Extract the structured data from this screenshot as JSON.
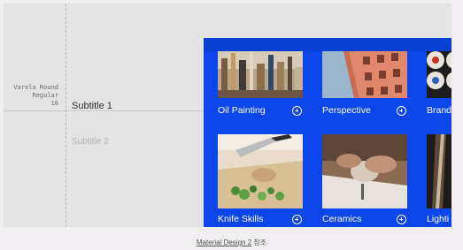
{
  "spec": {
    "font_name": "Varela Round",
    "font_weight": "Regular",
    "font_size": "16"
  },
  "samples": {
    "subtitle_1": "Subtitle 1",
    "subtitle_2": "Subtitle 2"
  },
  "colors": {
    "grid_background": "#0c46ea",
    "label": "#ffffff"
  },
  "tiles_row_1": [
    {
      "label": "Oil Painting",
      "icon": "add-circle-icon"
    },
    {
      "label": "Perspective",
      "icon": "add-circle-icon"
    },
    {
      "label": "Brand",
      "icon": "add-circle-icon"
    }
  ],
  "tiles_row_2": [
    {
      "label": "Knife Skills",
      "icon": "add-circle-icon"
    },
    {
      "label": "Ceramics",
      "icon": "add-circle-icon"
    },
    {
      "label": "Lighti",
      "icon": "add-circle-icon"
    }
  ],
  "caption": {
    "link_text": "Material Design 2",
    "suffix": " 참조"
  }
}
